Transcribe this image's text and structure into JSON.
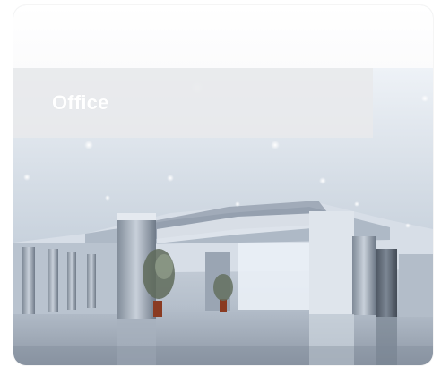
{
  "card": {
    "title": "Office"
  },
  "image": {
    "subject": "office-lobby-photo"
  },
  "colors": {
    "band": "#e8e9ec",
    "title_text": "#ffffff"
  }
}
